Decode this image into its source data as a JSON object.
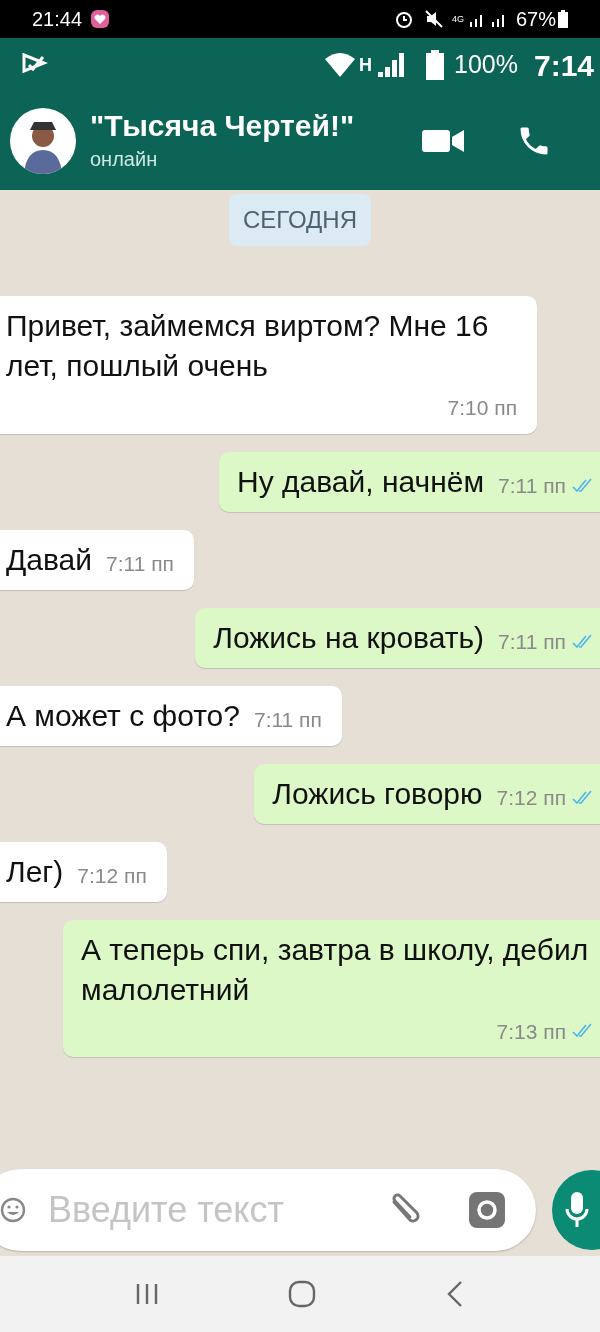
{
  "phone_status_bar": {
    "time": "21:44",
    "network": "4G",
    "battery": "67%"
  },
  "inner_status_bar": {
    "network": "Н",
    "battery": "100%",
    "time": "7:14"
  },
  "chat_header": {
    "title": "\"Тысяча Чертей!\"",
    "status": "онлайн"
  },
  "date_chip": "СЕГОДНЯ",
  "messages": [
    {
      "kind": "incoming",
      "text": "Привет, займемся виртом? Мне 16 лет, пошлый очень",
      "time": "7:10 пп"
    },
    {
      "kind": "outgoing",
      "text": "Ну давай, начнём",
      "time": "7:11 пп",
      "read": true
    },
    {
      "kind": "incoming",
      "text": "Давай",
      "time": "7:11 пп"
    },
    {
      "kind": "outgoing",
      "text": "Ложись на кровать)",
      "time": "7:11 пп",
      "read": true
    },
    {
      "kind": "incoming",
      "text": "А может с фото?",
      "time": "7:11 пп"
    },
    {
      "kind": "outgoing",
      "text": "Ложись говорю",
      "time": "7:12 пп",
      "read": true
    },
    {
      "kind": "incoming",
      "text": "Лег)",
      "time": "7:12 пп"
    },
    {
      "kind": "outgoing",
      "text": "А теперь спи, завтра в школу, дебил малолетний",
      "time": "7:13 пп",
      "read": true
    }
  ],
  "composer": {
    "placeholder": "Введите текст"
  }
}
